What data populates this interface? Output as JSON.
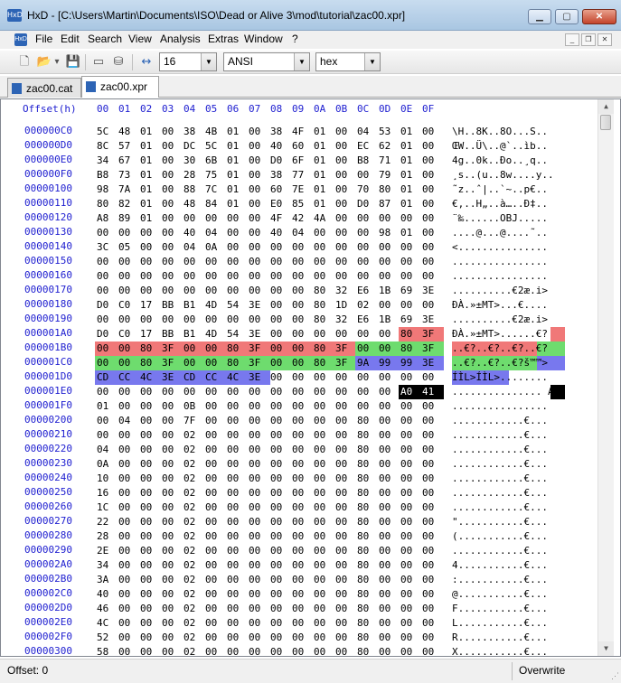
{
  "window": {
    "title": "HxD - [C:\\Users\\Martin\\Documents\\ISO\\Dead or Alive 3\\mod\\tutorial\\zac00.xpr]",
    "icon": "hxd-app-icon",
    "icon_text": "HxD",
    "btn_minimize": "▁",
    "btn_maximize": "▢",
    "btn_close": "✕"
  },
  "menu": {
    "items": [
      "File",
      "Edit",
      "Search",
      "View",
      "Analysis",
      "Extras",
      "Window",
      "?"
    ],
    "mdi_minimize": "_",
    "mdi_restore": "❐",
    "mdi_close": "✕"
  },
  "toolbar": {
    "icons": {
      "new": "🗋",
      "open": "📂",
      "open_dropdown": "▾",
      "save": "💾",
      "ram": "▭",
      "disk": "⛁",
      "bytes_per_row": "↔"
    },
    "bytes_per_row": "16",
    "charset": "ANSI",
    "offset_base": "hex",
    "dropdown_arrow": "▼"
  },
  "tabs": [
    {
      "label": "zac00.cat",
      "active": false
    },
    {
      "label": "zac00.xpr",
      "active": true
    }
  ],
  "hex_view": {
    "offset_header": "Offset(h)",
    "columns": [
      "00",
      "01",
      "02",
      "03",
      "04",
      "05",
      "06",
      "07",
      "08",
      "09",
      "0A",
      "0B",
      "0C",
      "0D",
      "0E",
      "0F"
    ],
    "rows": [
      {
        "offset": "000000C0",
        "bytes": [
          "5C",
          "48",
          "01",
          "00",
          "38",
          "4B",
          "01",
          "00",
          "38",
          "4F",
          "01",
          "00",
          "04",
          "53",
          "01",
          "00"
        ],
        "ascii": "\\H..8K..8O...S.."
      },
      {
        "offset": "000000D0",
        "bytes": [
          "8C",
          "57",
          "01",
          "00",
          "DC",
          "5C",
          "01",
          "00",
          "40",
          "60",
          "01",
          "00",
          "EC",
          "62",
          "01",
          "00"
        ],
        "ascii": "ŒW..Ü\\..@`..ìb.."
      },
      {
        "offset": "000000E0",
        "bytes": [
          "34",
          "67",
          "01",
          "00",
          "30",
          "6B",
          "01",
          "00",
          "D0",
          "6F",
          "01",
          "00",
          "B8",
          "71",
          "01",
          "00"
        ],
        "ascii": "4g..0k..Ðo..¸q.."
      },
      {
        "offset": "000000F0",
        "bytes": [
          "B8",
          "73",
          "01",
          "00",
          "28",
          "75",
          "01",
          "00",
          "38",
          "77",
          "01",
          "00",
          "00",
          "79",
          "01",
          "00"
        ],
        "ascii": "¸s..(u..8w....y.."
      },
      {
        "offset": "00000100",
        "bytes": [
          "98",
          "7A",
          "01",
          "00",
          "88",
          "7C",
          "01",
          "00",
          "60",
          "7E",
          "01",
          "00",
          "70",
          "80",
          "01",
          "00"
        ],
        "ascii": "˜z..ˆ|..`~..p€.."
      },
      {
        "offset": "00000110",
        "bytes": [
          "80",
          "82",
          "01",
          "00",
          "48",
          "84",
          "01",
          "00",
          "E0",
          "85",
          "01",
          "00",
          "D0",
          "87",
          "01",
          "00"
        ],
        "ascii": "€‚..H„..à…..Ð‡.."
      },
      {
        "offset": "00000120",
        "bytes": [
          "A8",
          "89",
          "01",
          "00",
          "00",
          "00",
          "00",
          "00",
          "4F",
          "42",
          "4A",
          "00",
          "00",
          "00",
          "00",
          "00"
        ],
        "ascii": "¨‰......OBJ....."
      },
      {
        "offset": "00000130",
        "bytes": [
          "00",
          "00",
          "00",
          "00",
          "40",
          "04",
          "00",
          "00",
          "40",
          "04",
          "00",
          "00",
          "00",
          "98",
          "01",
          "00"
        ],
        "ascii": "....@...@....˜.."
      },
      {
        "offset": "00000140",
        "bytes": [
          "3C",
          "05",
          "00",
          "00",
          "04",
          "0A",
          "00",
          "00",
          "00",
          "00",
          "00",
          "00",
          "00",
          "00",
          "00",
          "00"
        ],
        "ascii": "<..............."
      },
      {
        "offset": "00000150",
        "bytes": [
          "00",
          "00",
          "00",
          "00",
          "00",
          "00",
          "00",
          "00",
          "00",
          "00",
          "00",
          "00",
          "00",
          "00",
          "00",
          "00"
        ],
        "ascii": "................"
      },
      {
        "offset": "00000160",
        "bytes": [
          "00",
          "00",
          "00",
          "00",
          "00",
          "00",
          "00",
          "00",
          "00",
          "00",
          "00",
          "00",
          "00",
          "00",
          "00",
          "00"
        ],
        "ascii": "................"
      },
      {
        "offset": "00000170",
        "bytes": [
          "00",
          "00",
          "00",
          "00",
          "00",
          "00",
          "00",
          "00",
          "00",
          "00",
          "80",
          "32",
          "E6",
          "1B",
          "69",
          "3E"
        ],
        "ascii": "..........€2æ.i>"
      },
      {
        "offset": "00000180",
        "bytes": [
          "D0",
          "C0",
          "17",
          "BB",
          "B1",
          "4D",
          "54",
          "3E",
          "00",
          "00",
          "80",
          "1D",
          "02",
          "00",
          "00",
          "00"
        ],
        "ascii": "ÐÀ.»±MT>...€...."
      },
      {
        "offset": "00000190",
        "bytes": [
          "00",
          "00",
          "00",
          "00",
          "00",
          "00",
          "00",
          "00",
          "00",
          "00",
          "80",
          "32",
          "E6",
          "1B",
          "69",
          "3E"
        ],
        "ascii": "..........€2æ.i>"
      },
      {
        "offset": "000001A0",
        "bytes": [
          "D0",
          "C0",
          "17",
          "BB",
          "B1",
          "4D",
          "54",
          "3E",
          "00",
          "00",
          "00",
          "00",
          "00",
          "00",
          "80",
          "3F"
        ],
        "ascii": "ÐÀ.»±MT>......€?"
      },
      {
        "offset": "000001B0",
        "bytes": [
          "00",
          "00",
          "80",
          "3F",
          "00",
          "00",
          "80",
          "3F",
          "00",
          "00",
          "80",
          "3F",
          "00",
          "00",
          "80",
          "3F"
        ],
        "ascii": "..€?..€?..€?..€?"
      },
      {
        "offset": "000001C0",
        "bytes": [
          "00",
          "00",
          "80",
          "3F",
          "00",
          "00",
          "80",
          "3F",
          "00",
          "00",
          "80",
          "3F",
          "9A",
          "99",
          "99",
          "3E"
        ],
        "ascii": "..€?..€?..€?š™™>"
      },
      {
        "offset": "000001D0",
        "bytes": [
          "CD",
          "CC",
          "4C",
          "3E",
          "CD",
          "CC",
          "4C",
          "3E",
          "00",
          "00",
          "00",
          "00",
          "00",
          "00",
          "00",
          "00"
        ],
        "ascii": "ÍÌL>ÍÌL>........"
      },
      {
        "offset": "000001E0",
        "bytes": [
          "00",
          "00",
          "00",
          "00",
          "00",
          "00",
          "00",
          "00",
          "00",
          "00",
          "00",
          "00",
          "00",
          "00",
          "A0",
          "41"
        ],
        "ascii": "............... A"
      },
      {
        "offset": "000001F0",
        "bytes": [
          "01",
          "00",
          "00",
          "00",
          "0B",
          "00",
          "00",
          "00",
          "00",
          "00",
          "00",
          "00",
          "00",
          "00",
          "00",
          "00"
        ],
        "ascii": "................"
      },
      {
        "offset": "00000200",
        "bytes": [
          "00",
          "04",
          "00",
          "00",
          "7F",
          "00",
          "00",
          "00",
          "00",
          "00",
          "00",
          "00",
          "80",
          "00",
          "00",
          "00"
        ],
        "ascii": "............€..."
      },
      {
        "offset": "00000210",
        "bytes": [
          "00",
          "00",
          "00",
          "00",
          "02",
          "00",
          "00",
          "00",
          "00",
          "00",
          "00",
          "00",
          "80",
          "00",
          "00",
          "00"
        ],
        "ascii": "............€..."
      },
      {
        "offset": "00000220",
        "bytes": [
          "04",
          "00",
          "00",
          "00",
          "02",
          "00",
          "00",
          "00",
          "00",
          "00",
          "00",
          "00",
          "80",
          "00",
          "00",
          "00"
        ],
        "ascii": "............€..."
      },
      {
        "offset": "00000230",
        "bytes": [
          "0A",
          "00",
          "00",
          "00",
          "02",
          "00",
          "00",
          "00",
          "00",
          "00",
          "00",
          "00",
          "80",
          "00",
          "00",
          "00"
        ],
        "ascii": "............€..."
      },
      {
        "offset": "00000240",
        "bytes": [
          "10",
          "00",
          "00",
          "00",
          "02",
          "00",
          "00",
          "00",
          "00",
          "00",
          "00",
          "00",
          "80",
          "00",
          "00",
          "00"
        ],
        "ascii": "............€..."
      },
      {
        "offset": "00000250",
        "bytes": [
          "16",
          "00",
          "00",
          "00",
          "02",
          "00",
          "00",
          "00",
          "00",
          "00",
          "00",
          "00",
          "80",
          "00",
          "00",
          "00"
        ],
        "ascii": "............€..."
      },
      {
        "offset": "00000260",
        "bytes": [
          "1C",
          "00",
          "00",
          "00",
          "02",
          "00",
          "00",
          "00",
          "00",
          "00",
          "00",
          "00",
          "80",
          "00",
          "00",
          "00"
        ],
        "ascii": "............€..."
      },
      {
        "offset": "00000270",
        "bytes": [
          "22",
          "00",
          "00",
          "00",
          "02",
          "00",
          "00",
          "00",
          "00",
          "00",
          "00",
          "00",
          "80",
          "00",
          "00",
          "00"
        ],
        "ascii": "\"...........€..."
      },
      {
        "offset": "00000280",
        "bytes": [
          "28",
          "00",
          "00",
          "00",
          "02",
          "00",
          "00",
          "00",
          "00",
          "00",
          "00",
          "00",
          "80",
          "00",
          "00",
          "00"
        ],
        "ascii": "(...........€..."
      },
      {
        "offset": "00000290",
        "bytes": [
          "2E",
          "00",
          "00",
          "00",
          "02",
          "00",
          "00",
          "00",
          "00",
          "00",
          "00",
          "00",
          "80",
          "00",
          "00",
          "00"
        ],
        "ascii": "............€..."
      },
      {
        "offset": "000002A0",
        "bytes": [
          "34",
          "00",
          "00",
          "00",
          "02",
          "00",
          "00",
          "00",
          "00",
          "00",
          "00",
          "00",
          "80",
          "00",
          "00",
          "00"
        ],
        "ascii": "4...........€..."
      },
      {
        "offset": "000002B0",
        "bytes": [
          "3A",
          "00",
          "00",
          "00",
          "02",
          "00",
          "00",
          "00",
          "00",
          "00",
          "00",
          "00",
          "80",
          "00",
          "00",
          "00"
        ],
        "ascii": ":...........€..."
      },
      {
        "offset": "000002C0",
        "bytes": [
          "40",
          "00",
          "00",
          "00",
          "02",
          "00",
          "00",
          "00",
          "00",
          "00",
          "00",
          "00",
          "80",
          "00",
          "00",
          "00"
        ],
        "ascii": "@...........€..."
      },
      {
        "offset": "000002D0",
        "bytes": [
          "46",
          "00",
          "00",
          "00",
          "02",
          "00",
          "00",
          "00",
          "00",
          "00",
          "00",
          "00",
          "80",
          "00",
          "00",
          "00"
        ],
        "ascii": "F...........€..."
      },
      {
        "offset": "000002E0",
        "bytes": [
          "4C",
          "00",
          "00",
          "00",
          "02",
          "00",
          "00",
          "00",
          "00",
          "00",
          "00",
          "00",
          "80",
          "00",
          "00",
          "00"
        ],
        "ascii": "L...........€..."
      },
      {
        "offset": "000002F0",
        "bytes": [
          "52",
          "00",
          "00",
          "00",
          "02",
          "00",
          "00",
          "00",
          "00",
          "00",
          "00",
          "00",
          "80",
          "00",
          "00",
          "00"
        ],
        "ascii": "R...........€..."
      },
      {
        "offset": "00000300",
        "bytes": [
          "58",
          "00",
          "00",
          "00",
          "02",
          "00",
          "00",
          "00",
          "00",
          "00",
          "00",
          "00",
          "80",
          "00",
          "00",
          "00"
        ],
        "ascii": "X...........€..."
      }
    ],
    "highlight_colors": {
      "y1": "#f07878",
      "y2": "#6edc6e",
      "y3": "#7878ee",
      "sel": "#000000"
    },
    "highlights": [
      {
        "row": 14,
        "from": 14,
        "to": 15,
        "kind": "y1"
      },
      {
        "row": 15,
        "from": 0,
        "to": 11,
        "kind": "y1"
      },
      {
        "row": 15,
        "from": 12,
        "to": 15,
        "kind": "y2"
      },
      {
        "row": 16,
        "from": 0,
        "to": 11,
        "kind": "y2"
      },
      {
        "row": 16,
        "from": 12,
        "to": 15,
        "kind": "y3"
      },
      {
        "row": 17,
        "from": 0,
        "to": 7,
        "kind": "y3"
      },
      {
        "row": 18,
        "from": 14,
        "to": 15,
        "kind": "sel"
      }
    ],
    "scroll_up": "▲",
    "scroll_down": "▼"
  },
  "status": {
    "offset": "Offset: 0",
    "mode": "Overwrite",
    "grip": "⋰"
  }
}
